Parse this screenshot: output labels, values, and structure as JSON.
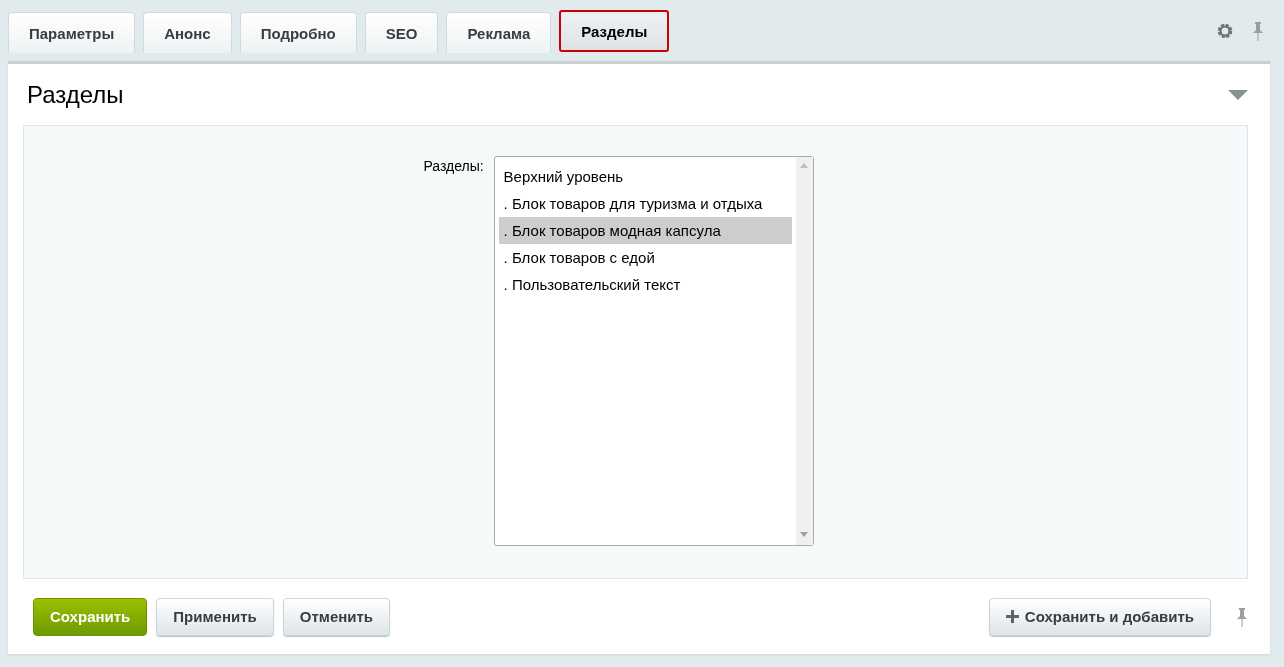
{
  "tabs": [
    {
      "label": "Параметры",
      "selected": false
    },
    {
      "label": "Анонс",
      "selected": false
    },
    {
      "label": "Подробно",
      "selected": false
    },
    {
      "label": "SEO",
      "selected": false
    },
    {
      "label": "Реклама",
      "selected": false
    },
    {
      "label": "Разделы",
      "selected": true
    }
  ],
  "section": {
    "title": "Разделы",
    "expanded": true
  },
  "field": {
    "label": "Разделы:",
    "options": [
      {
        "label": "Верхний уровень",
        "selected": false
      },
      {
        "label": ". Блок товаров для туризма и отдыха",
        "selected": false
      },
      {
        "label": ". Блок товаров модная капсула",
        "selected": true
      },
      {
        "label": ". Блок товаров с едой",
        "selected": false
      },
      {
        "label": ". Пользовательский текст",
        "selected": false
      }
    ]
  },
  "buttons": [
    {
      "label": "Сохранить",
      "kind": "primary"
    },
    {
      "label": "Применить",
      "kind": "default"
    },
    {
      "label": "Отменить",
      "kind": "default"
    },
    {
      "label": "Сохранить и добавить",
      "kind": "add"
    }
  ]
}
